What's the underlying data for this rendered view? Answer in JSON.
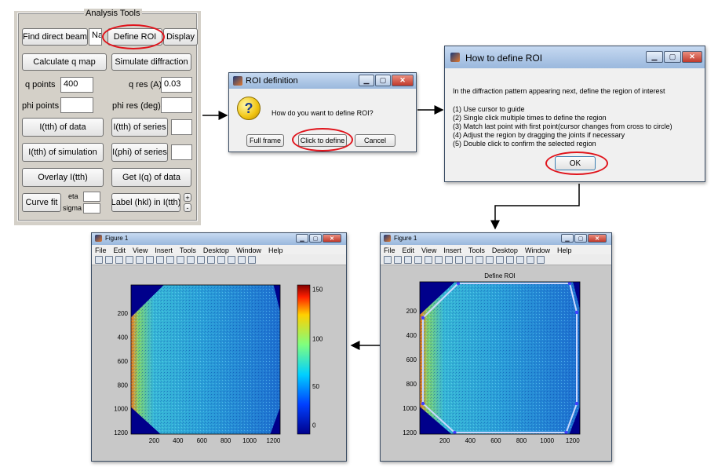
{
  "panel": {
    "legend": "Analysis Tools",
    "find_direct_beam": "Find direct beam",
    "na_value": "Na",
    "define_roi": "Define ROI",
    "display": "Display",
    "calc_q_map": "Calculate q map",
    "sim_diffraction": "Simulate diffraction",
    "q_points_label": "q points",
    "q_points_value": "400",
    "q_res_label": "q res (A)",
    "q_res_value": "0.03",
    "phi_points_label": "phi points",
    "phi_res_label": "phi res (deg)",
    "ith_data": "I(tth) of data",
    "ith_series": "I(tth) of series",
    "ith_sim": "I(tth) of simulation",
    "iphi_series": "I(phi) of series",
    "overlay": "Overlay I(tth)",
    "get_iq": "Get I(q) of data",
    "curve_fit": "Curve fit",
    "eta_label": "eta",
    "sigma_label": "sigma",
    "label_hkl": "Label (hkl) in I(tth)",
    "plus": "+",
    "minus": "-"
  },
  "roi_dialog": {
    "title": "ROI definition",
    "question": "How do you want to define ROI?",
    "full_frame": "Full frame",
    "click_to_define": "Click to define",
    "cancel": "Cancel",
    "icon": "?"
  },
  "howto_dialog": {
    "title": "How to define ROI",
    "intro": "In the diffraction pattern appearing next, define the region of interest",
    "steps": [
      "(1) Use cursor to guide",
      "(2) Single click multiple times to define the region",
      "(3) Match last point with first point(cursor changes from cross to circle)",
      "(4) Adjust the region by dragging the joints if necessary",
      "(5) Double click to confirm the selected region"
    ],
    "ok": "OK"
  },
  "figure_left": {
    "title": "Figure 1",
    "menus": [
      "File",
      "Edit",
      "View",
      "Insert",
      "Tools",
      "Desktop",
      "Window",
      "Help"
    ],
    "yticks": [
      "200",
      "400",
      "600",
      "800",
      "1000",
      "1200"
    ],
    "xticks": [
      "200",
      "400",
      "600",
      "800",
      "1000",
      "1200"
    ],
    "cbar_ticks": [
      "150",
      "100",
      "50",
      "0"
    ]
  },
  "figure_right": {
    "title": "Figure 1",
    "menus": [
      "File",
      "Edit",
      "View",
      "Insert",
      "Tools",
      "Desktop",
      "Window",
      "Help"
    ],
    "plot_title": "Define ROI",
    "yticks": [
      "200",
      "400",
      "600",
      "800",
      "1000",
      "1200"
    ],
    "xticks": [
      "200",
      "400",
      "600",
      "800",
      "1000",
      "1200"
    ]
  },
  "colors": {
    "highlight": "#e0141c",
    "plot_bg": "#00008b",
    "window_frame": "#3a4c63"
  }
}
